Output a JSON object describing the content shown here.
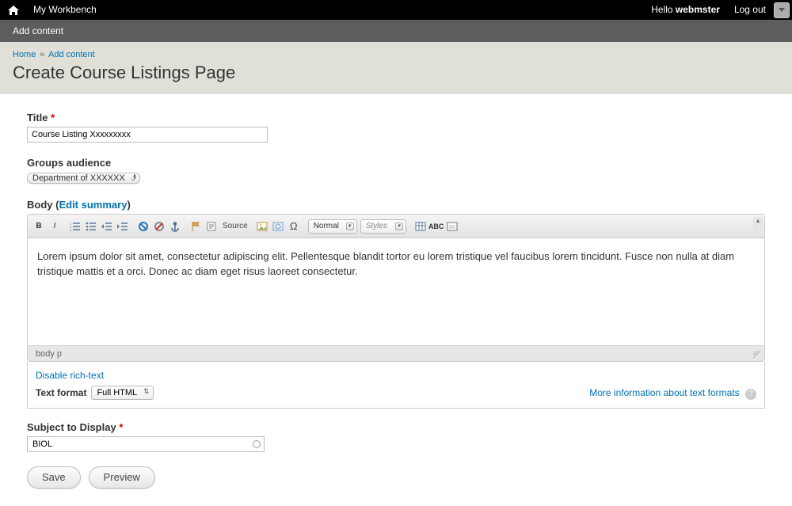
{
  "topbar": {
    "workbench": "My Workbench",
    "hello_prefix": "Hello ",
    "username": "webmster",
    "logout": "Log out"
  },
  "subbar": {
    "add_content": "Add content"
  },
  "breadcrumb": {
    "home": "Home",
    "sep": "»",
    "add_content": "Add content"
  },
  "page_title": "Create Course Listings Page",
  "fields": {
    "title_label": "Title",
    "title_value": "Course Listing Xxxxxxxxx",
    "groups_label": "Groups audience",
    "groups_value": "Department of XXXXXX",
    "body_label_prefix": "Body (",
    "body_edit_summary": "Edit summary",
    "body_label_suffix": ")",
    "body_content": "Lorem ipsum dolor sit amet, consectetur adipiscing elit. Pellentesque blandit tortor eu lorem tristique vel faucibus lorem tincidunt. Fusce non nulla at diam tristique mattis et a orci. Donec ac diam eget risus laoreet consectetur.",
    "editor_footer": "body  p",
    "disable_rich_text": "Disable rich-text",
    "text_format_label": "Text format",
    "text_format_value": "Full HTML",
    "more_info": "More information about text formats",
    "subject_label": "Subject to Display",
    "subject_value": "BIOL"
  },
  "toolbar": {
    "source_label": "Source",
    "format_value": "Normal",
    "styles_value": "Styles"
  },
  "actions": {
    "save": "Save",
    "preview": "Preview"
  }
}
